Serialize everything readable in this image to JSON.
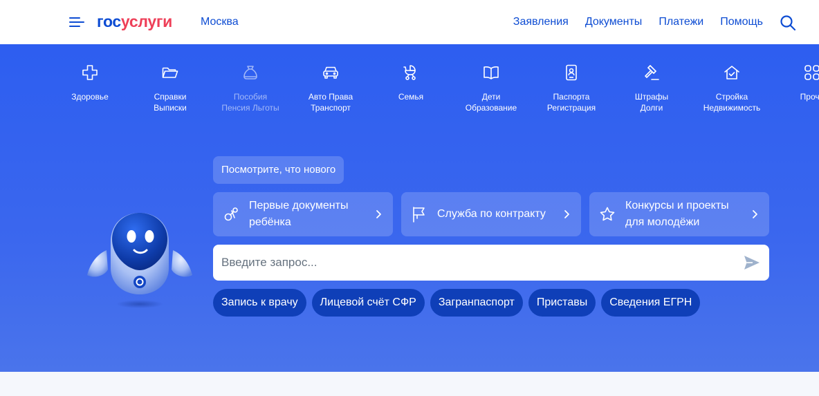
{
  "header": {
    "logo_part1": "гос",
    "logo_part2": "услуги",
    "city": "Москва",
    "nav": [
      {
        "label": "Заявления"
      },
      {
        "label": "Документы"
      },
      {
        "label": "Платежи"
      },
      {
        "label": "Помощь"
      }
    ],
    "icons": {
      "menu": "burger-menu-icon",
      "search": "search-icon"
    }
  },
  "categories": [
    {
      "line1": "Здоровье",
      "line2": "",
      "icon": "health-cross-icon"
    },
    {
      "line1": "Справки",
      "line2": "Выписки",
      "icon": "folder-icon"
    },
    {
      "line1": "Пособия",
      "line2": "Пенсия Льготы",
      "icon": "coin-bag-icon"
    },
    {
      "line1": "Авто Права",
      "line2": "Транспорт",
      "icon": "car-icon"
    },
    {
      "line1": "Семья",
      "line2": "",
      "icon": "stroller-icon"
    },
    {
      "line1": "Дети",
      "line2": "Образование",
      "icon": "book-icon"
    },
    {
      "line1": "Паспорта",
      "line2": "Регистрация",
      "icon": "passport-icon"
    },
    {
      "line1": "Штрафы",
      "line2": "Долги",
      "icon": "gavel-icon"
    },
    {
      "line1": "Стройка",
      "line2": "Недвижимость",
      "icon": "house-icon"
    },
    {
      "line1": "Проче",
      "line2": "",
      "icon": "grid-icon"
    }
  ],
  "hero": {
    "news_chip": "Посмотрите, что нового",
    "promos": [
      {
        "label": "Первые документы ребёнка",
        "icon": "pacifier-icon"
      },
      {
        "label": "Служба по контракту",
        "icon": "flag-icon"
      },
      {
        "label": "Конкурсы и проекты для молодёжи",
        "icon": "star-icon"
      }
    ],
    "search": {
      "placeholder": "Введите запрос...",
      "value": ""
    },
    "quick_chips": [
      {
        "label": "Запись к врачу"
      },
      {
        "label": "Лицевой счёт СФР"
      },
      {
        "label": "Загранпаспорт"
      },
      {
        "label": "Приставы"
      },
      {
        "label": "Сведения ЕГРН"
      }
    ]
  },
  "colors": {
    "brand_blue": "#0d4cd3",
    "brand_red": "#ee3f58",
    "hero_bg": "#2d5ef0",
    "chip_dark": "#0f3fb8"
  }
}
